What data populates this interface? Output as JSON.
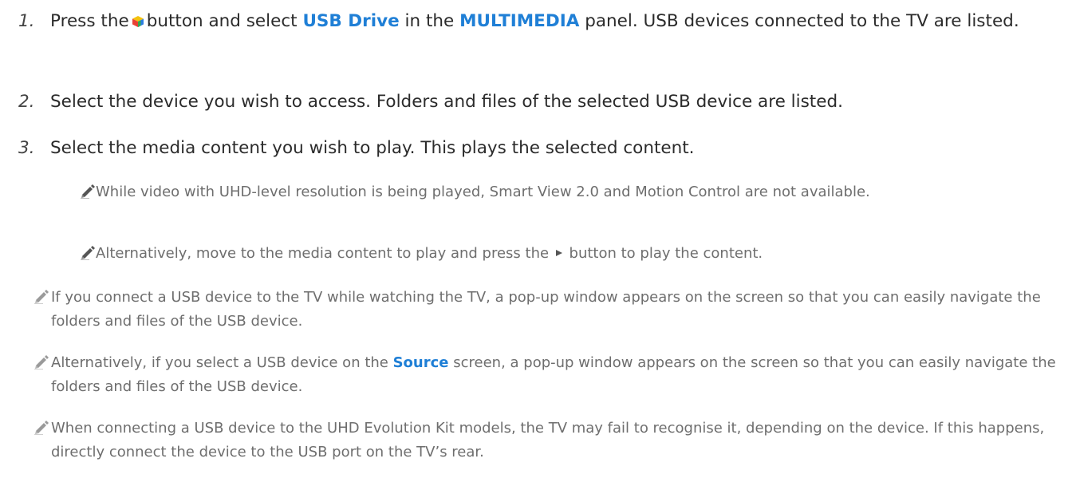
{
  "steps": [
    {
      "num": "1.",
      "t1": "Press the",
      "t2": "button and select",
      "k1": "USB Drive",
      "t3": "in the",
      "k2": "MULTIMEDIA",
      "t4": "panel. USB devices connected to the TV are listed."
    },
    {
      "num": "2.",
      "text": "Select the device you wish to access. Folders and files of the selected USB device are listed."
    },
    {
      "num": "3.",
      "text": "Select the media content you wish to play. This plays the selected content."
    }
  ],
  "sub_notes": [
    {
      "text": "While video with UHD-level resolution is being played, Smart View 2.0 and Motion Control are not available."
    },
    {
      "t1": "Alternatively, move to the media content to play and press the",
      "t2": "button to play the content."
    }
  ],
  "notes": [
    {
      "text": "If you connect a USB device to the TV while watching the TV, a pop-up window appears on the screen so that you can easily navigate the folders and files of the USB device."
    },
    {
      "t1": "Alternatively, if you select a USB device on the",
      "k1": "Source",
      "t2": "screen, a pop-up window appears on the screen so that you can easily navigate the folders and files of the USB device."
    },
    {
      "text": "When connecting a USB device to the UHD Evolution Kit models, the TV may fail to recognise it, depending on the device. If this happens, directly connect the device to the USB port on the TV’s rear."
    }
  ],
  "icons": {
    "menu": "smart-hub-menu-icon",
    "play": "play-icon",
    "note": "pencil-note-icon"
  },
  "colors": {
    "keyword": "#1f7fd6",
    "body_text": "#2b2b2b",
    "note_text": "#6e6e6e"
  }
}
